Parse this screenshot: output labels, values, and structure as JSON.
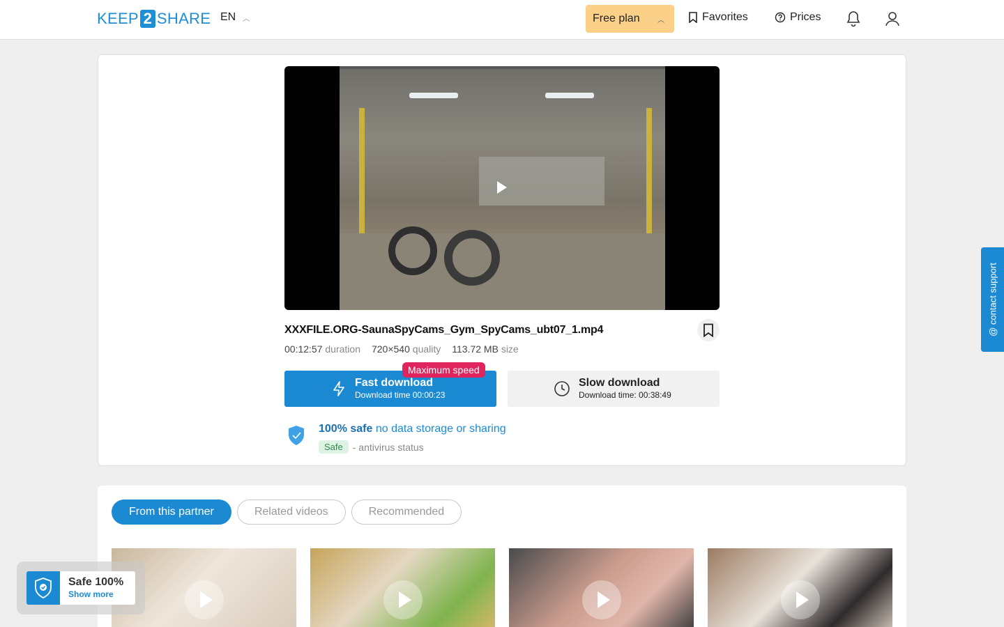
{
  "header": {
    "logo": {
      "left": "KEEP",
      "mid": "2",
      "right": "SHARE"
    },
    "language": "EN",
    "plan_label": "Free plan",
    "favorites_label": "Favorites",
    "prices_label": "Prices"
  },
  "file": {
    "name": "XXXFILE.ORG-SaunaSpyCams_Gym_SpyCams_ubt07_1.mp4",
    "duration_value": "00:12:57",
    "duration_label": "duration",
    "quality_value": "720×540",
    "quality_label": "quality",
    "size_value": "113.72 MB",
    "size_label": "size"
  },
  "download": {
    "max_speed_badge": "Maximum speed",
    "fast_title": "Fast download",
    "fast_sub": "Download time 00:00:23",
    "slow_title": "Slow download",
    "slow_sub": "Download time: 00:38:49"
  },
  "safety": {
    "bold": "100% safe",
    "rest": "no data storage or sharing",
    "tag": "Safe",
    "antivirus": "- antivirus status"
  },
  "support_label": "@ contact support",
  "tabs": [
    "From this partner",
    "Related videos",
    "Recommended"
  ],
  "popup": {
    "title": "Safe 100%",
    "link": "Show more"
  },
  "colors": {
    "accent": "#1b8ad3",
    "plan": "#fbd089",
    "badge": "#e0245e"
  }
}
